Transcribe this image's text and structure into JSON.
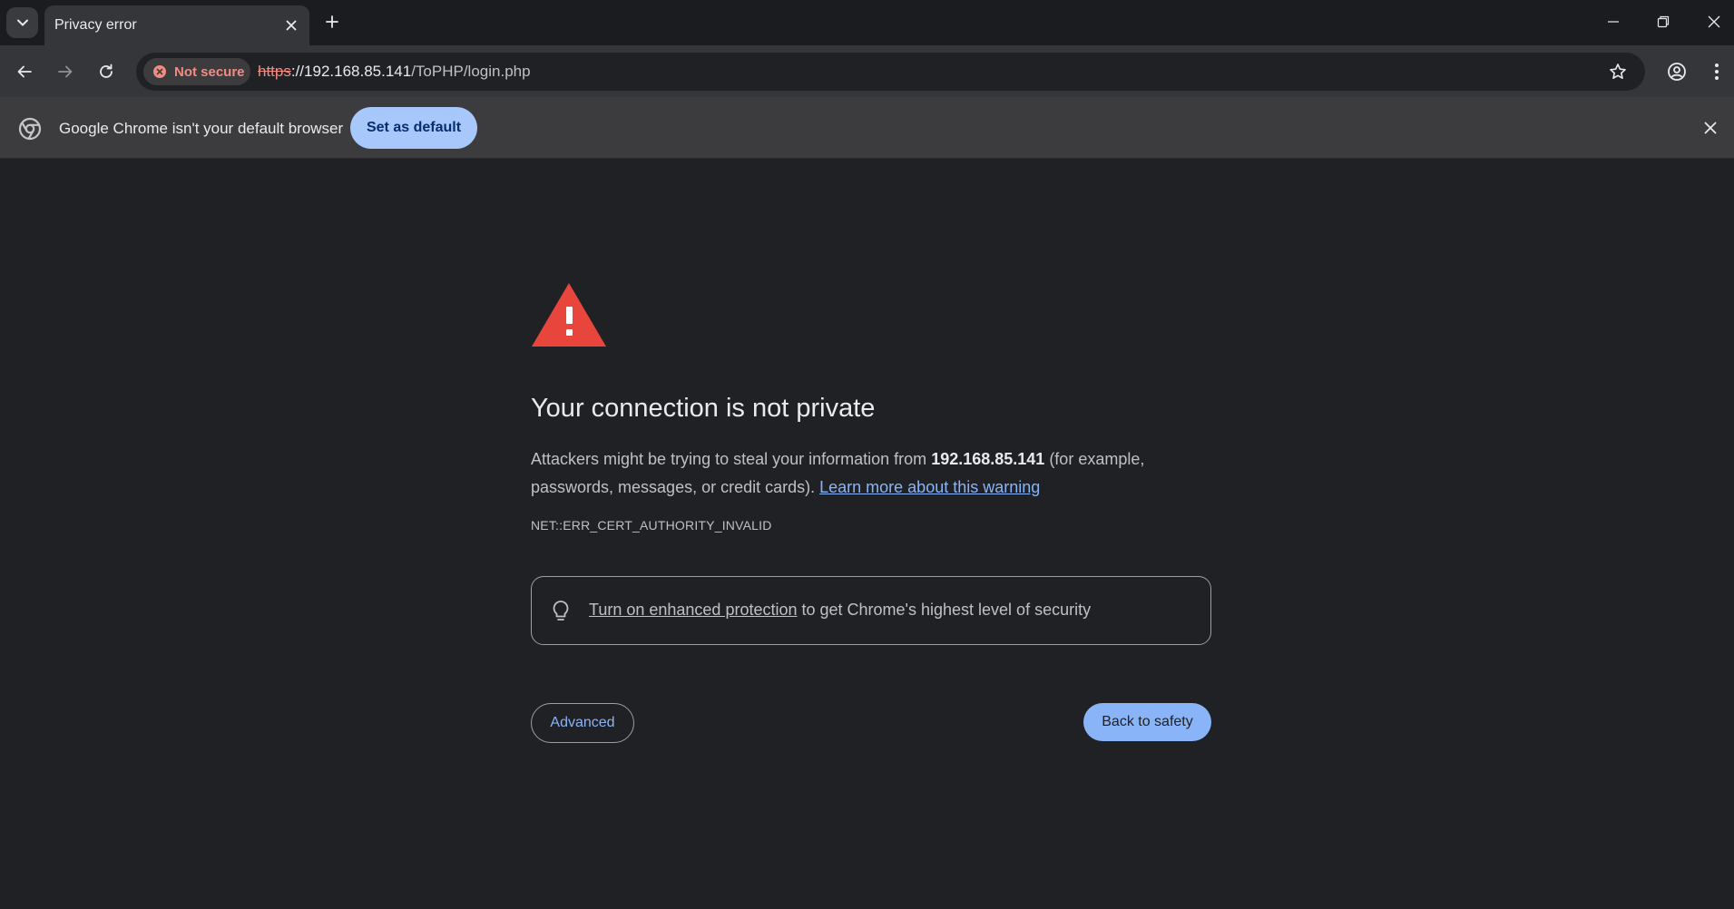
{
  "tab": {
    "title": "Privacy error"
  },
  "toolbar": {
    "security_chip": "Not secure",
    "url_scheme": "https",
    "url_host": "://192.168.85.141",
    "url_path": "/ToPHP/login.php"
  },
  "infobar": {
    "text": "Google Chrome isn't your default browser",
    "button": "Set as default"
  },
  "interstitial": {
    "heading": "Your connection is not private",
    "explanation_pre": "Attackers might be trying to steal your information from ",
    "host": "192.168.85.141",
    "explanation_post": " (for example, passwords, messages, or credit cards). ",
    "learn_more": "Learn more about this warning",
    "error_code": "NET::ERR_CERT_AUTHORITY_INVALID",
    "enhanced_link": "Turn on enhanced protection",
    "enhanced_rest": " to get Chrome's highest level of security",
    "advanced_button": "Advanced",
    "back_button": "Back to safety"
  },
  "colors": {
    "page_bg": "#202124",
    "warning_red": "#e8453c",
    "link_blue": "#8ab4f8",
    "not_secure_red": "#f28b82",
    "primary_button": "#8ab4f8"
  },
  "icons": [
    "tab-search-icon",
    "close-icon",
    "plus-icon",
    "minimize-icon",
    "restore-icon",
    "back-arrow-icon",
    "forward-arrow-icon",
    "reload-icon",
    "not-secure-icon",
    "star-icon",
    "profile-icon",
    "menu-icon",
    "chrome-logo-icon",
    "warning-triangle-icon",
    "lightbulb-icon"
  ]
}
